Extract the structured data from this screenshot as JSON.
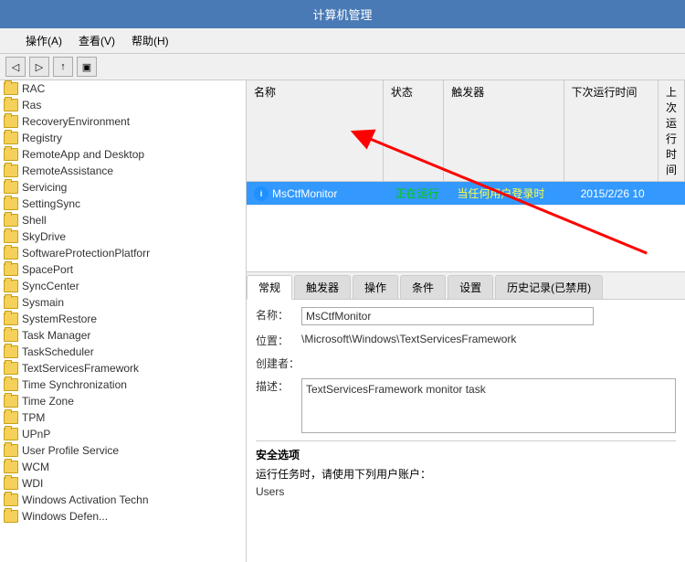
{
  "titleBar": {
    "title": "计算机管理"
  },
  "menuBar": {
    "items": [
      {
        "label": "操作(A)"
      },
      {
        "label": "查看(V)"
      },
      {
        "label": "帮助(H)"
      }
    ]
  },
  "toolbar": {
    "buttons": [
      "←",
      "→",
      "⬆",
      "□"
    ]
  },
  "leftPanel": {
    "items": [
      "RAC",
      "Ras",
      "RecoveryEnvironment",
      "Registry",
      "RemoteApp and Desktop",
      "RemoteAssistance",
      "Servicing",
      "SettingSync",
      "Shell",
      "SkyDrive",
      "SoftwareProtectionPlatforr",
      "SpacePort",
      "SyncCenter",
      "Sysmain",
      "SystemRestore",
      "Task Manager",
      "TaskScheduler",
      "TextServicesFramework",
      "Time Synchronization",
      "Time Zone",
      "TPM",
      "UPnP",
      "User Profile Service",
      "WCM",
      "WDI",
      "Windows Activation Techn",
      "Windows Defen..."
    ]
  },
  "taskTable": {
    "columns": [
      "名称",
      "状态",
      "触发器",
      "下次运行时间",
      "上次运行时间"
    ],
    "columnWidths": [
      "160px",
      "70px",
      "120px",
      "100px",
      "80px"
    ],
    "rows": [
      {
        "name": "MsCtfMonitor",
        "status": "正在运行",
        "trigger": "当任何用户登录时",
        "nextRun": "2015/2/26 10",
        "lastRun": "",
        "selected": true
      }
    ]
  },
  "tabs": [
    {
      "label": "常规",
      "active": true
    },
    {
      "label": "触发器",
      "active": false
    },
    {
      "label": "操作",
      "active": false
    },
    {
      "label": "条件",
      "active": false
    },
    {
      "label": "设置",
      "active": false
    },
    {
      "label": "历史记录(已禁用)",
      "active": false
    }
  ],
  "details": {
    "nameLabel": "名称：",
    "nameValue": "MsCtfMonitor",
    "locationLabel": "位置：",
    "locationValue": "\\Microsoft\\Windows\\TextServicesFramework",
    "authorLabel": "创建者：",
    "authorValue": "",
    "descLabel": "描述：",
    "descValue": "TextServicesFramework monitor task",
    "securityLabel": "安全选项",
    "runAsLabel": "运行任务时，请使用下列用户账户：",
    "runAsValue": "Users"
  }
}
